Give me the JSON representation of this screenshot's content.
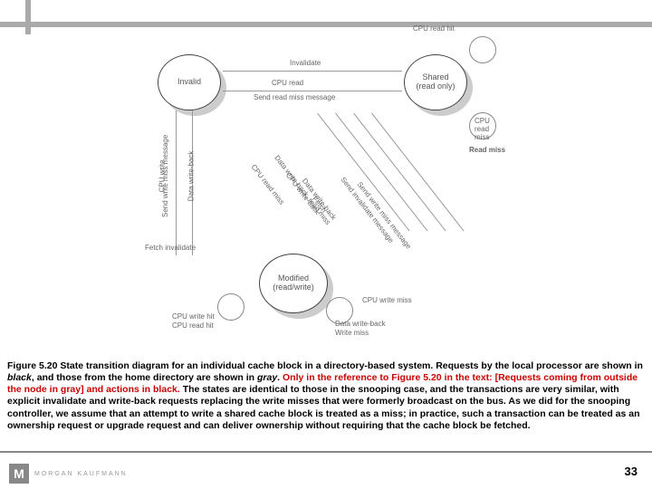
{
  "states": {
    "invalid": "Invalid",
    "shared_l1": "Shared",
    "shared_l2": "(read only)",
    "modified_l1": "Modified",
    "modified_l2": "(read/write)"
  },
  "labels": {
    "cpu_read_hit": "CPU read hit",
    "invalidate": "Invalidate",
    "cpu_read": "CPU read",
    "send_read_miss": "Send read miss message",
    "cpu_write": "CPU write",
    "send_write_miss": "Send write miss message",
    "data_wb": "Data write-back",
    "fetch_inv": "Fetch invalidate",
    "cpu_rm_l1": "CPU read miss",
    "cpu_rm_l2": "Data write-back, read miss",
    "cpu_wb_l1": "CPU write-back",
    "cpu_wb_l2": "Data write-back",
    "fetch": "Fetch",
    "send_inv": "Send invalidate message",
    "send_wm": "Send write miss message",
    "cpu_write_miss": "CPU write miss",
    "cpu_read_miss2": "CPU read miss",
    "read_miss": "Read miss",
    "cpu_wh": "CPU write hit",
    "cpu_rh": "CPU read hit",
    "dwb_wm": "Data write-back",
    "wm": "Write miss"
  },
  "caption": {
    "p1a": "Figure 5.20 State transition diagram for an individual cache block in a directory-based system. Requests by the local processor are shown in ",
    "p1b": "black",
    "p1c": ", and those from the home directory are shown in ",
    "p1d": "gray",
    "p1e": ". ",
    "red": "Only in the reference to Figure 5.20 in the text: [Requests coming from outside the node in gray] and actions in black.",
    "p2": " The states are identical to those in the snooping case, and the transactions are very similar, with explicit invalidate and write-back requests replacing the write misses that were formerly broadcast on the bus. As we did for the snooping controller, we assume that an attempt to write a shared cache block is treated as a miss; in practice, such a transaction can be treated as an ownership request or upgrade request and can deliver ownership without requiring that the cache block be fetched."
  },
  "footer": {
    "publisher": "MORGAN KAUFMANN",
    "logo": "M",
    "page": "33"
  }
}
